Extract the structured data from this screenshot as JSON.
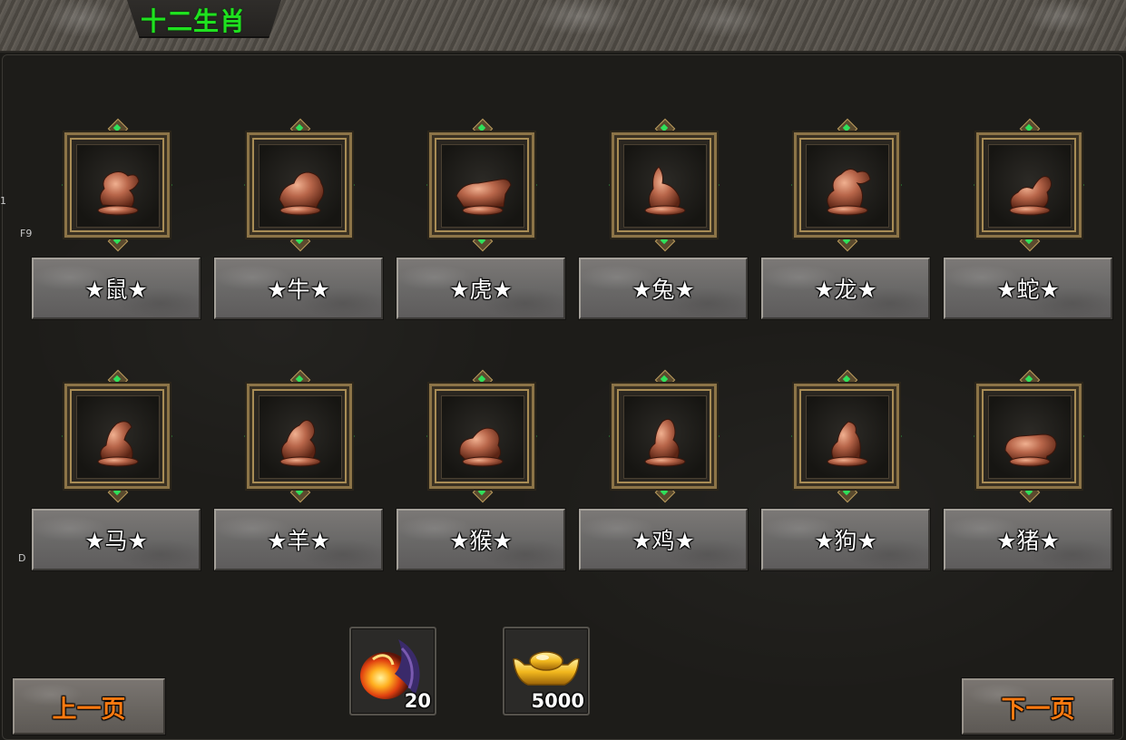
{
  "window": {
    "title": "十二生肖"
  },
  "side_labels": {
    "top_marker": "1",
    "f9": "F9",
    "d": "D"
  },
  "zodiac": [
    {
      "name": "★鼠★",
      "icon": "rat-statue-icon"
    },
    {
      "name": "★牛★",
      "icon": "ox-statue-icon"
    },
    {
      "name": "★虎★",
      "icon": "tiger-statue-icon"
    },
    {
      "name": "★兔★",
      "icon": "rabbit-statue-icon"
    },
    {
      "name": "★龙★",
      "icon": "dragon-statue-icon"
    },
    {
      "name": "★蛇★",
      "icon": "snake-statue-icon"
    },
    {
      "name": "★马★",
      "icon": "horse-statue-icon"
    },
    {
      "name": "★羊★",
      "icon": "goat-statue-icon"
    },
    {
      "name": "★猴★",
      "icon": "monkey-statue-icon"
    },
    {
      "name": "★鸡★",
      "icon": "rooster-statue-icon"
    },
    {
      "name": "★狗★",
      "icon": "dog-statue-icon"
    },
    {
      "name": "★猪★",
      "icon": "pig-statue-icon"
    }
  ],
  "costs": [
    {
      "icon": "phoenix-feather-icon",
      "count": "20"
    },
    {
      "icon": "gold-ingot-icon",
      "count": "5000"
    }
  ],
  "nav": {
    "prev_label": "上一页",
    "next_label": "下一页"
  },
  "colors": {
    "title": "#1fe21f",
    "page_button_text": "#ff7a10",
    "statue": "#b8664a",
    "frame_gold": "#8c7447",
    "arrow_green": "#2fbf4a"
  }
}
